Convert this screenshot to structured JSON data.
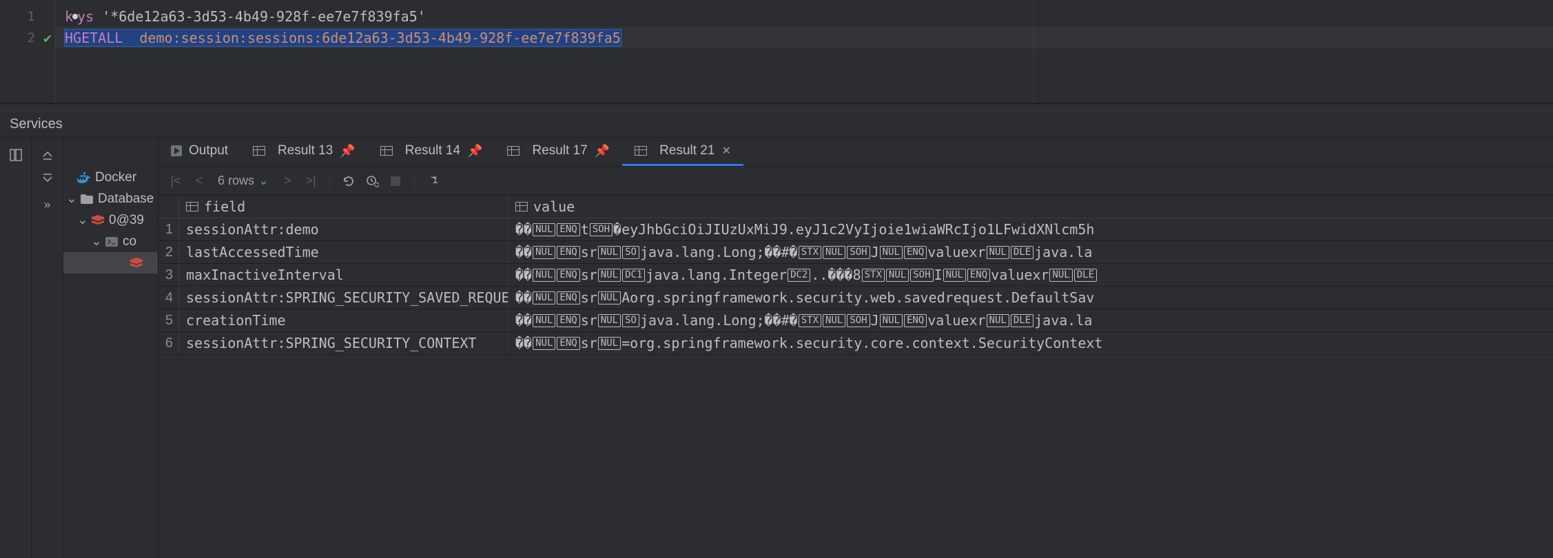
{
  "editor": {
    "lines": [
      {
        "num": "1",
        "kw_pre": "k",
        "kw_post": "ys",
        "arg": "'*6de12a63-3d53-4b49-928f-ee7e7f839fa5'",
        "has_caret_dot": true
      },
      {
        "num": "2",
        "kw": "HGETALL",
        "arg": "demo:session:sessions:6de12a63-3d53-4b49-928f-ee7e7f839fa5",
        "has_check": true,
        "selected": true
      }
    ]
  },
  "services_title": "Services",
  "tree": {
    "docker": "Docker",
    "database": "Database",
    "node": "0@39",
    "conn": "co"
  },
  "tabs": {
    "output": "Output",
    "r13": "Result 13",
    "r14": "Result 14",
    "r17": "Result 17",
    "r21": "Result 21"
  },
  "toolbar": {
    "rowcount": "6 rows"
  },
  "columns": {
    "field": "field",
    "value": "value"
  },
  "rows": [
    {
      "n": "1",
      "field": "sessionAttr:demo",
      "value": [
        "��",
        {
          "c": "NUL"
        },
        {
          "c": "ENQ"
        },
        "t",
        {
          "c": "SOH"
        },
        "�eyJhbGciOiJIUzUxMiJ9.eyJ1c2VyIjoie1wiaWRcIjo1LFwidXNlcm5h"
      ]
    },
    {
      "n": "2",
      "field": "lastAccessedTime",
      "value": [
        "��",
        {
          "c": "NUL"
        },
        {
          "c": "ENQ"
        },
        "sr",
        {
          "c": "NUL"
        },
        {
          "c": "SO"
        },
        "java.lang.Long;��#�",
        {
          "c": "STX"
        },
        {
          "c": "NUL"
        },
        {
          "c": "SOH"
        },
        "J",
        {
          "c": "NUL"
        },
        {
          "c": "ENQ"
        },
        "valuexr",
        {
          "c": "NUL"
        },
        {
          "c": "DLE"
        },
        "java.la"
      ]
    },
    {
      "n": "3",
      "field": "maxInactiveInterval",
      "value": [
        "��",
        {
          "c": "NUL"
        },
        {
          "c": "ENQ"
        },
        "sr",
        {
          "c": "NUL"
        },
        {
          "c": "DC1"
        },
        "java.lang.Integer",
        {
          "c": "DC2"
        },
        "..���8",
        {
          "c": "STX"
        },
        {
          "c": "NUL"
        },
        {
          "c": "SOH"
        },
        "I",
        {
          "c": "NUL"
        },
        {
          "c": "ENQ"
        },
        "valuexr",
        {
          "c": "NUL"
        },
        {
          "c": "DLE"
        }
      ]
    },
    {
      "n": "4",
      "field": "sessionAttr:SPRING_SECURITY_SAVED_REQUEST",
      "value": [
        "��",
        {
          "c": "NUL"
        },
        {
          "c": "ENQ"
        },
        "sr",
        {
          "c": "NUL"
        },
        " Aorg.springframework.security.web.savedrequest.DefaultSav"
      ]
    },
    {
      "n": "5",
      "field": "creationTime",
      "value": [
        "��",
        {
          "c": "NUL"
        },
        {
          "c": "ENQ"
        },
        "sr",
        {
          "c": "NUL"
        },
        {
          "c": "SO"
        },
        "java.lang.Long;��#�",
        {
          "c": "STX"
        },
        {
          "c": "NUL"
        },
        {
          "c": "SOH"
        },
        "J",
        {
          "c": "NUL"
        },
        {
          "c": "ENQ"
        },
        "valuexr",
        {
          "c": "NUL"
        },
        {
          "c": "DLE"
        },
        "java.la"
      ]
    },
    {
      "n": "6",
      "field": "sessionAttr:SPRING_SECURITY_CONTEXT",
      "value": [
        "��",
        {
          "c": "NUL"
        },
        {
          "c": "ENQ"
        },
        "sr",
        {
          "c": "NUL"
        },
        " =org.springframework.security.core.context.SecurityContext"
      ]
    }
  ]
}
